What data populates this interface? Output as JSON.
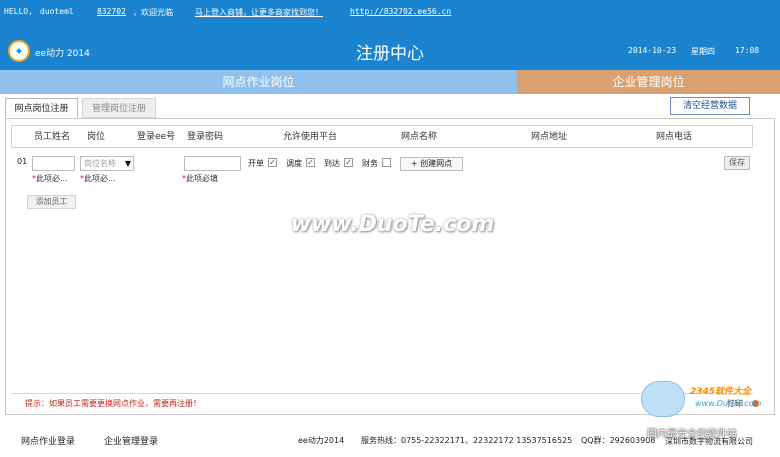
{
  "topbar": {
    "greeting": "HELLO,",
    "username": "duoteml",
    "user_id": "832702",
    "welcome": "，欢迎光临",
    "promo": "马上登入商铺，让更多商家找到您！",
    "shop_url": "http://832702.ee56.cn",
    "app_name": "ee动力 2014",
    "page_title": "注册中心",
    "date": "2014-10-23",
    "weekday": "星期四",
    "time": "17:08"
  },
  "roles": {
    "left": "网点作业岗位",
    "right": "企业管理岗位"
  },
  "subtabs": {
    "active": "网点岗位注册",
    "inactive": "管理岗位注册",
    "clear_button": "清空经营数据"
  },
  "table": {
    "headers": [
      "员工姓名",
      "岗位",
      "登录ee号",
      "登录密码",
      "允许使用平台",
      "网点名称",
      "网点地址",
      "网点电话"
    ]
  },
  "row": {
    "number": "01",
    "position_placeholder": "岗位名称",
    "required_short": "此项必...",
    "required_full": "此项必填",
    "platforms": [
      {
        "label": "开单",
        "checked": "✓"
      },
      {
        "label": "调度",
        "checked": "✓"
      },
      {
        "label": "到达",
        "checked": "✓"
      },
      {
        "label": "财务",
        "checked": ""
      }
    ],
    "create_button": "+ 创建网点",
    "save_button": "保存",
    "add_button": "添加员工"
  },
  "watermark": "www.DuoTe.com",
  "tip": "提示：如果员工需要更换网点作业，需要再注册！",
  "print_label": "打印",
  "corner_watermark": {
    "brand": "2345软件大全",
    "site": "www.DuoTe.com",
    "slogan": "国内最安全的软件站"
  },
  "footer": {
    "link1": "网点作业登录",
    "link2": "企业管理登录",
    "app": "ee动力2014",
    "hotline": "服务热线：0755-22322171、22322172  13537516525",
    "qq": "QQ群：292603908",
    "company": "深圳市数字物流有限公司"
  },
  "colors": {
    "topbar": "#1a84d0",
    "role_left": "#8fc1ec",
    "role_right": "#d9a170",
    "required": "#d01d1d"
  }
}
